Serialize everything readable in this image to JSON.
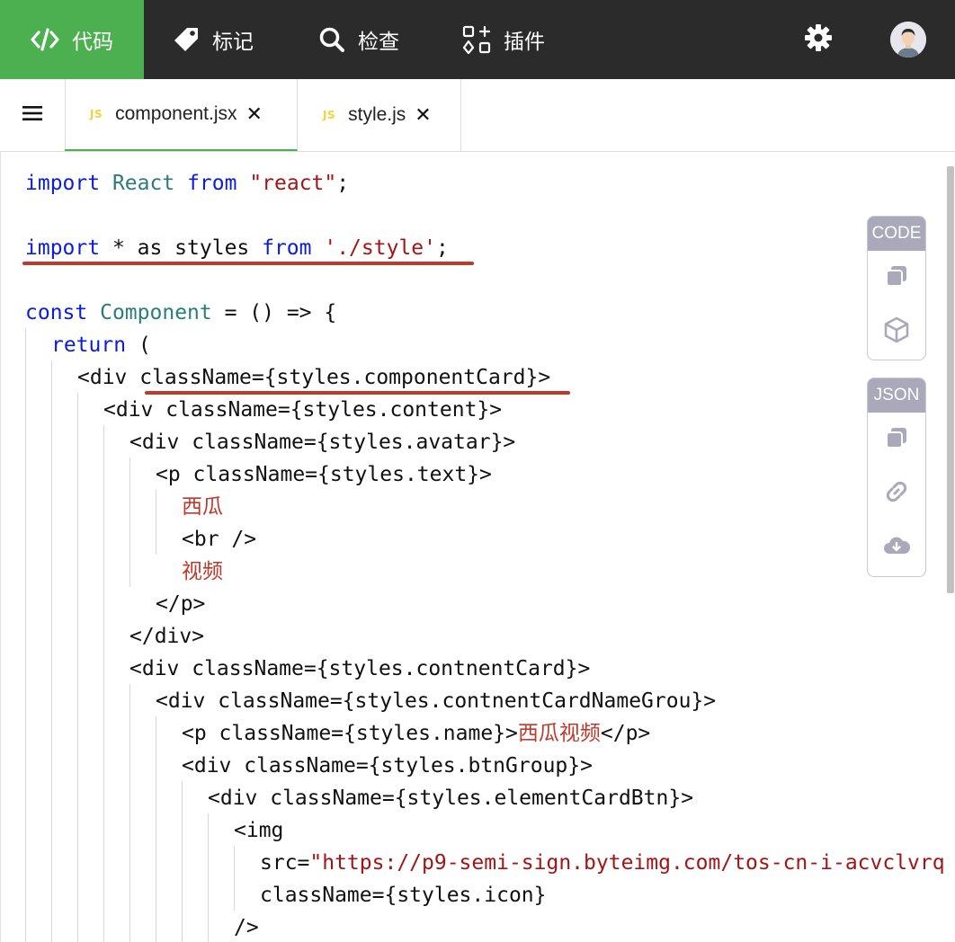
{
  "nav": {
    "items": [
      {
        "label": "代码",
        "icon": "code-icon",
        "active": true
      },
      {
        "label": "标记",
        "icon": "tag-icon"
      },
      {
        "label": "检查",
        "icon": "search-icon"
      },
      {
        "label": "插件",
        "icon": "plugin-grid-icon"
      }
    ],
    "settings_icon": "gear-icon",
    "avatar_icon": "user-avatar"
  },
  "tabs": [
    {
      "badge": "JS",
      "label": "component.jsx",
      "active": true
    },
    {
      "badge": "JS",
      "label": "style.js",
      "active": false
    }
  ],
  "toolbar": {
    "code_label": "CODE",
    "json_label": "JSON",
    "code_buttons": [
      "copy-icon",
      "cube-icon"
    ],
    "json_buttons": [
      "copy-icon",
      "link-icon",
      "cloud-download-icon"
    ]
  },
  "code_lines": [
    "import React from \"react\";",
    "",
    "import * as styles from './style';",
    "",
    "const Component = () => {",
    "return (",
    "<div className={styles.componentCard}>",
    "<div className={styles.content}>",
    "<div className={styles.avatar}>",
    "<p className={styles.text}>",
    "西瓜",
    "<br />",
    "视频",
    "</p>",
    "</div>",
    "<div className={styles.contnentCard}>",
    "<div className={styles.contnentCardNameGrou}>",
    "<p className={styles.name}>西瓜视频</p>",
    "<div className={styles.btnGroup}>",
    "<div className={styles.elementCardBtn}>",
    "<img",
    "src=\"https://p9-semi-sign.byteimg.com/tos-cn-i-acvclvrq",
    "className={styles.icon}",
    "/>"
  ],
  "colors": {
    "nav_bg": "#2b2b2b",
    "nav_active": "#4caf50",
    "keyword": "#0a1ddc",
    "type": "#2a7d7d",
    "string": "#a31515",
    "highlight_underline": "#c0392b"
  }
}
